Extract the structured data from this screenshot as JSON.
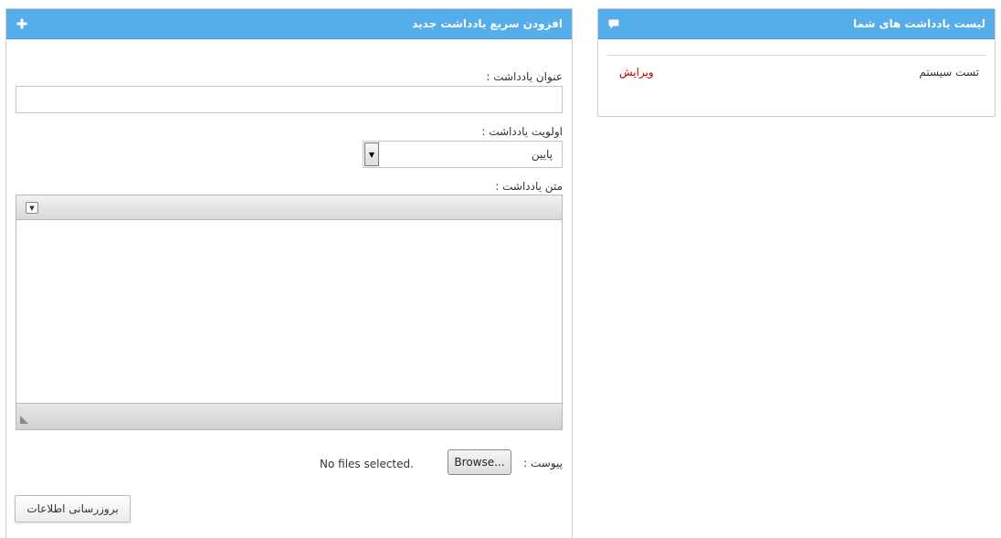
{
  "form_panel": {
    "title": "افزودن سریع یادداشت جدید",
    "header_icon": "plus-icon",
    "title_label": "عنوان یادداشت :",
    "title_value": "",
    "priority_label": "اولویت یادداشت :",
    "priority_selected": "پایین",
    "body_label": "متن یادداشت :",
    "attach_label": "پیوست :",
    "browse_label": "Browse...",
    "no_file_text": "No files selected.",
    "submit_label": "بروزرسانی اطلاعات"
  },
  "list_panel": {
    "title": "لیست یادداشت های شما",
    "header_icon": "comment-icon",
    "items": [
      {
        "title": "تست سیستم",
        "edit_label": "ویرایش"
      }
    ]
  },
  "colors": {
    "header_bg": "#55aeea",
    "edit_link": "#c00000"
  }
}
